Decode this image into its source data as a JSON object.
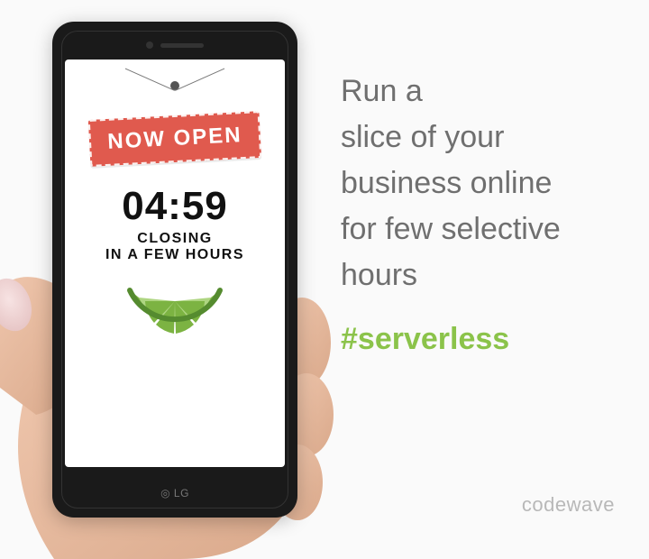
{
  "phone": {
    "logo": "LG",
    "sign_label": "NOW OPEN",
    "time": "04:59",
    "closing_line1": "CLOSING",
    "closing_line2": "IN A FEW HOURS"
  },
  "copy": {
    "line1": "Run a",
    "line2": "slice of your",
    "line3": "business online",
    "line4": "for few selective",
    "line5": "hours",
    "hashtag": "#serverless"
  },
  "brand": "codewave",
  "colors": {
    "accent_green": "#8bc34a",
    "sign_red": "#e05a4e",
    "text_gray": "#6f6f6f"
  },
  "icons": {
    "lime": "lime-slice-icon"
  }
}
